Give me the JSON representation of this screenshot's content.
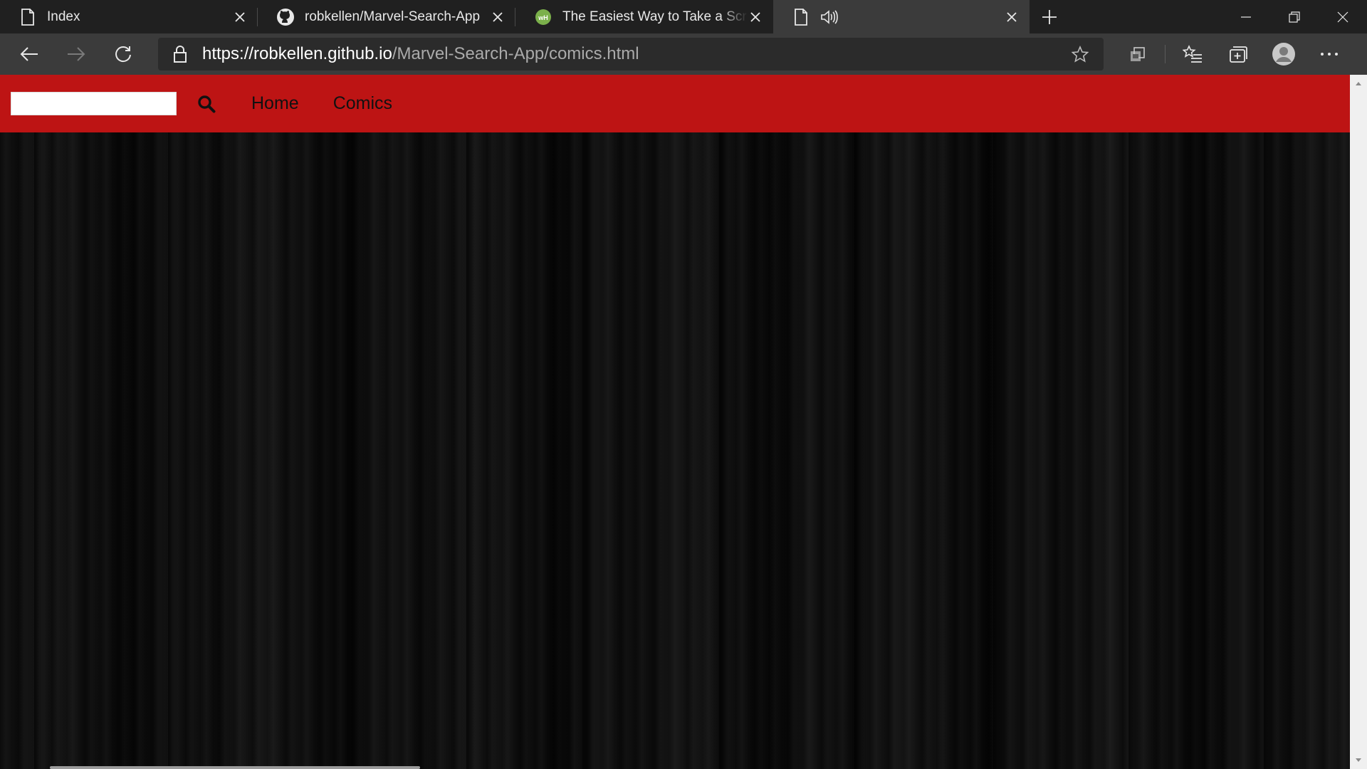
{
  "tabs": [
    {
      "title": "Index",
      "icon": "page-icon",
      "active": false
    },
    {
      "title": "robkellen/Marvel-Search-App",
      "icon": "github-icon",
      "active": false
    },
    {
      "title": "The Easiest Way to Take a Screenshot",
      "icon": "site-favicon",
      "active": false
    },
    {
      "title": "",
      "icon": "page-icon",
      "active": true,
      "audio": true
    }
  ],
  "address_bar": {
    "scheme": "https://",
    "domain": "robkellen.github.io",
    "path": "/Marvel-Search-App/comics.html"
  },
  "site": {
    "nav_background": "#bd1414",
    "search_value": "",
    "nav_links": [
      "Home",
      "Comics"
    ]
  },
  "colors": {
    "tabstrip": "#202020",
    "toolbar": "#3b3b3b",
    "address_field": "#2b2b2b"
  }
}
